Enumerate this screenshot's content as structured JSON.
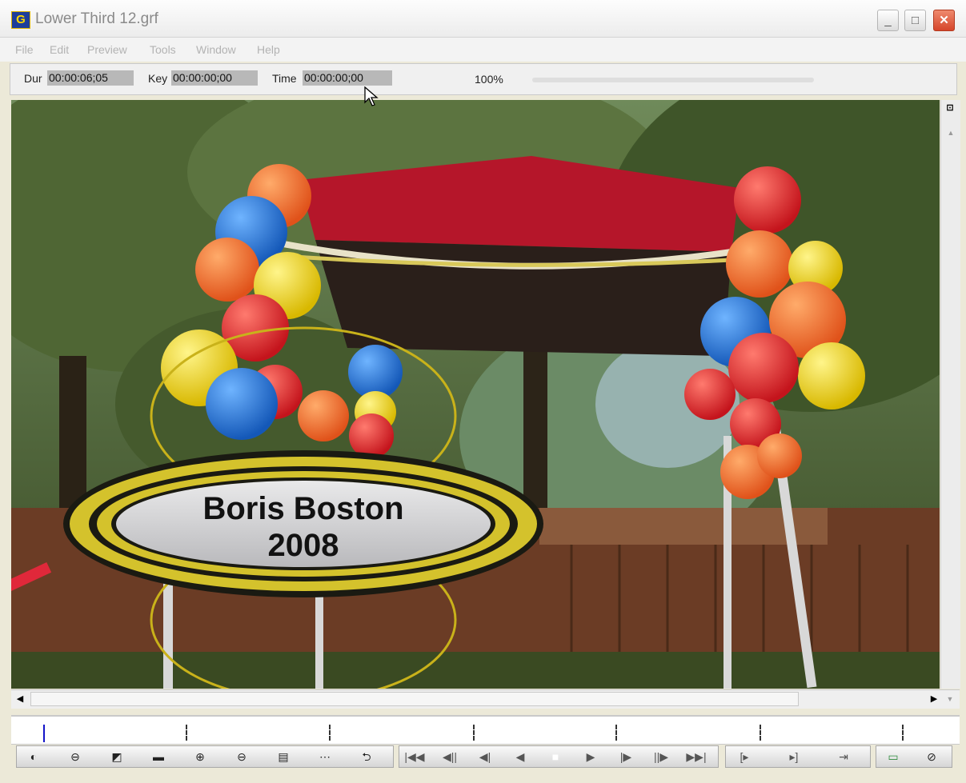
{
  "window": {
    "app_icon_letter": "G",
    "title": "Lower Third 12.grf",
    "controls": {
      "minimize": "_",
      "maximize": "□",
      "close": "✕"
    }
  },
  "menu": [
    "File",
    "Edit",
    "Preview",
    "Tools",
    "Window",
    "Help"
  ],
  "timebar": {
    "dur_label": "Dur",
    "dur_value": "00:00:06;05",
    "key_label": "Key",
    "key_value": "00:00:00;00",
    "time_label": "Time",
    "time_value": "00:00:00;00",
    "zoom": "100%"
  },
  "preview": {
    "lower_third_line1": "Boris Boston",
    "lower_third_line2": "2008"
  },
  "scrollbars": {
    "vertical_top_icon": "⊡",
    "up_arrow": "▲",
    "left_arrow": "◀",
    "right_arrow": "▶",
    "down_arrow": "▼"
  },
  "toolbar": {
    "view_group": [
      "◐",
      "⊖",
      "◩",
      "▬",
      "⊕",
      "⊖",
      "▤",
      "⋯",
      "⮌"
    ],
    "transport_group": [
      "|◀◀",
      "◀||",
      "◀|",
      "◀",
      "■",
      "▶",
      "|▶",
      "||▶",
      "▶▶|"
    ],
    "mark_group": [
      "[▸",
      "▸]",
      "⇥"
    ],
    "extra_group": [
      "▭",
      "⊘"
    ]
  },
  "icons": {
    "app_icon": "graphics-app-icon",
    "cursor": "mouse-pointer-icon"
  }
}
